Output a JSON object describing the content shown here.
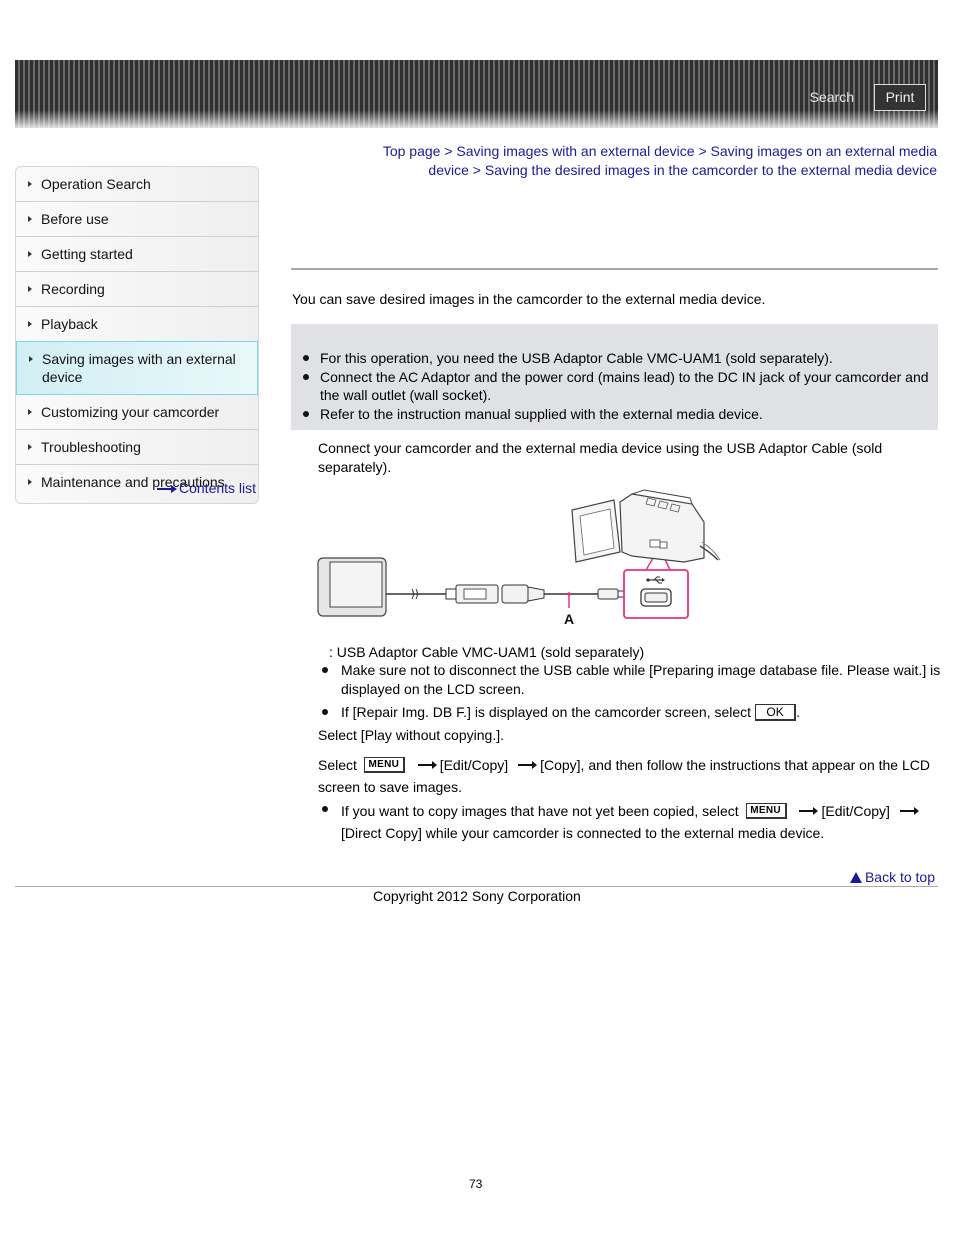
{
  "header": {
    "search_label": "Search",
    "print_label": "Print"
  },
  "sidebar": {
    "items": [
      {
        "label": "Operation Search",
        "active": false
      },
      {
        "label": "Before use",
        "active": false
      },
      {
        "label": "Getting started",
        "active": false
      },
      {
        "label": "Recording",
        "active": false
      },
      {
        "label": "Playback",
        "active": false
      },
      {
        "label": "Saving images with an external device",
        "active": true
      },
      {
        "label": "Customizing your camcorder",
        "active": false
      },
      {
        "label": "Troubleshooting",
        "active": false
      },
      {
        "label": "Maintenance and precautions",
        "active": false
      }
    ],
    "contents_link": "Contents list"
  },
  "breadcrumb": {
    "items": [
      "Top page",
      "Saving images with an external device",
      "Saving images on an external media device",
      "Saving the desired images in the camcorder to the external media device"
    ],
    "separator": ">"
  },
  "main": {
    "intro": "You can save desired images in the camcorder to the external media device.",
    "notes": [
      "For this operation, you need the USB Adaptor Cable VMC-UAM1 (sold separately).",
      "Connect the AC Adaptor and the power cord (mains lead) to the DC IN jack of your camcorder and the wall outlet (wall socket).",
      "Refer to the instruction manual supplied with the external media device."
    ],
    "step1": "Connect your camcorder and the external media device using the USB Adaptor Cable (sold separately).",
    "diagram_label": "A",
    "legend_a": ": USB Adaptor Cable VMC-UAM1 (sold separately)",
    "step1_notes": [
      "Make sure not to disconnect the USB cable while [Preparing image database file. Please wait.] is displayed on the LCD screen.",
      "If [Repair Img. DB F.] is displayed on the camcorder screen, select"
    ],
    "ok_button": "OK",
    "step2": "Select [Play without copying.].",
    "step3": {
      "prefix": "Select",
      "menu_button": "MENU",
      "part1": "[Edit/Copy]",
      "part2": "[Copy], and then follow the instructions that appear on the LCD screen to save images."
    },
    "step3_note": {
      "prefix": "If you want to copy images that have not yet been copied, select",
      "menu_button": "MENU",
      "part1": "[Edit/Copy]",
      "part2": "[Direct Copy] while your camcorder is connected to the external media device."
    }
  },
  "footer": {
    "back_to_top": "Back to top",
    "copyright": "Copyright 2012 Sony Corporation",
    "page_number": "73"
  },
  "colors": {
    "link": "#1a1a99",
    "accent_pink": "#e8308a",
    "note_bg": "#dfe1e5",
    "active_border": "#7fd3e3"
  }
}
